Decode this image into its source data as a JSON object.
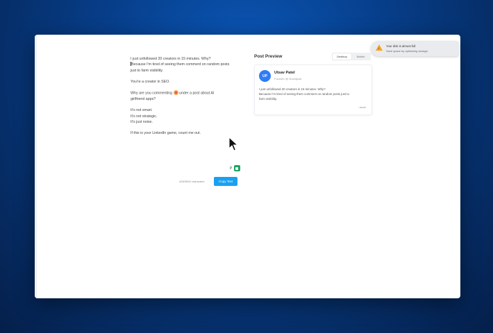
{
  "editor": {
    "paragraphs": [
      [
        "I just unfollowed 20 creators in 15 minutes. Why?",
        "Because I'm tired of seeing them comment on random posts",
        "just to farm visibility."
      ],
      [
        "You're a creator in SEO."
      ],
      [
        "Why are you commenting",
        "under a post about AI",
        "girlfriend apps?"
      ],
      [
        "It's not smart.",
        "It's not strategic.",
        "It's just noise."
      ],
      [
        "If this is your LinkedIn game, count me out."
      ]
    ],
    "char_count": "428/3000 characters",
    "copy_label": "Copy Text",
    "p_label": "P"
  },
  "preview": {
    "title": "Post Preview",
    "toggle": [
      "Desktop",
      "Mobile"
    ],
    "active_toggle": "Desktop",
    "avatar_initials": "UP",
    "name": "Utsav Patel",
    "role": "Founder @ Guestpost",
    "post_lines": [
      "I just unfollowed 20 creators in 15 minutes. Why?",
      "Because I'm tired of seeing them comment on random posts just to",
      "farm visibility."
    ],
    "more": "...more"
  },
  "toast": {
    "title": "Your disk is almost full",
    "body": "Save space by optimizing storage."
  },
  "colors": {
    "accent": "#1aa0f0",
    "avatar": "#2f7df6",
    "warning": "#f4a623",
    "meet": "#1fa463"
  }
}
